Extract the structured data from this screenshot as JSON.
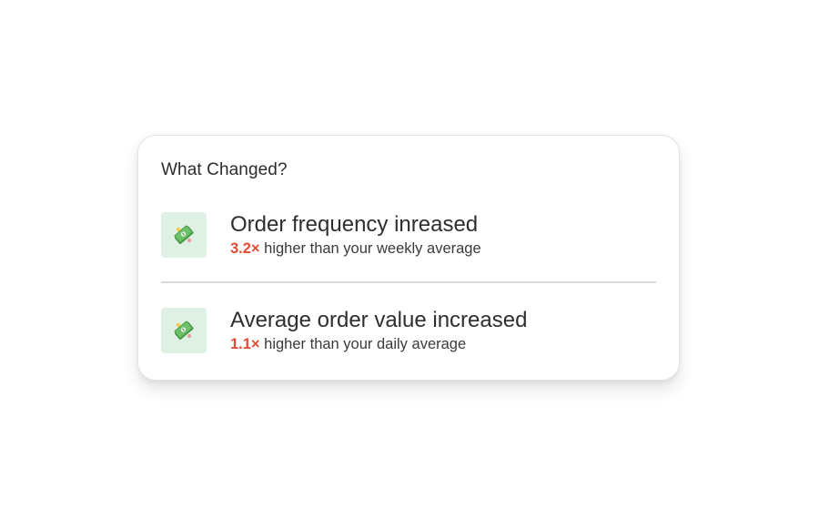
{
  "card": {
    "title": "What Changed?",
    "items": [
      {
        "icon": "money-bills-icon",
        "heading": "Order frequency inreased",
        "multiplier": "3.2×",
        "detail": " higher than your weekly average"
      },
      {
        "icon": "money-bills-icon",
        "heading": "Average order value increased",
        "multiplier": "1.1×",
        "detail": " higher than your daily average"
      }
    ]
  },
  "colors": {
    "accent": "#e54b33",
    "icon_tile": "#dff1e4",
    "money_green": "#5cae5b"
  }
}
